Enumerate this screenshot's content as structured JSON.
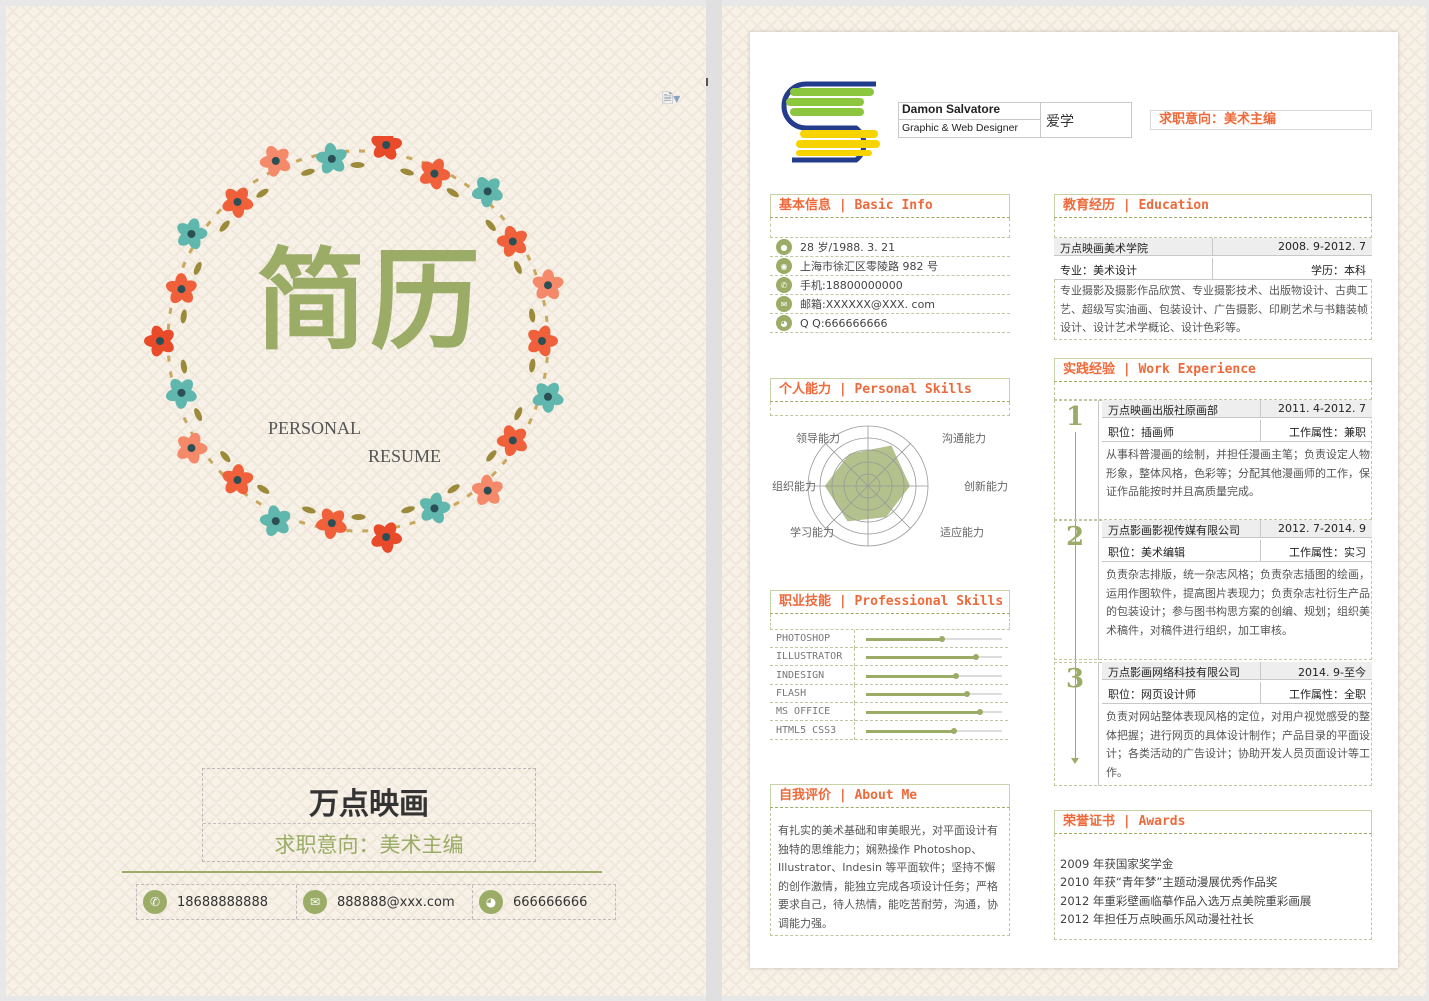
{
  "left": {
    "title": "简历",
    "subtitle_1": "PERSONAL",
    "subtitle_2": "RESUME",
    "name": "万点映画",
    "intent": "求职意向：美术主编",
    "contacts": [
      {
        "icon": "phone-icon",
        "glyph": "✆",
        "text": "18688888888"
      },
      {
        "icon": "mail-icon",
        "glyph": "✉",
        "text": "888888@xxx.com"
      },
      {
        "icon": "qq-icon",
        "glyph": "◕",
        "text": "666666666"
      }
    ]
  },
  "header": {
    "name": "Damon Salvatore",
    "role": "Graphic & Web Designer",
    "motto": "爱学",
    "intent": "求职意向：美术主编"
  },
  "basic": {
    "title": "基本信息 | Basic Info",
    "items": [
      {
        "icon": "user-icon",
        "text": "28 岁/1988. 3. 21"
      },
      {
        "icon": "location-icon",
        "text": "上海市徐汇区零陵路 982 号"
      },
      {
        "icon": "phone-icon",
        "text": "手机:18800000000"
      },
      {
        "icon": "mail-icon",
        "text": "邮箱:XXXXXX@XXX. com"
      },
      {
        "icon": "qq-icon",
        "text": "Q  Q:666666666"
      }
    ]
  },
  "personal": {
    "title": "个人能力 | Personal Skills",
    "labels": [
      "领导能力",
      "沟通能力",
      "组织能力",
      "创新能力",
      "学习能力",
      "适应能力"
    ],
    "values": [
      0.62,
      0.78,
      0.72,
      0.7,
      0.68,
      0.6
    ]
  },
  "professional": {
    "title": "职业技能 | Professional Skills",
    "skills": [
      {
        "name": "PHOTOSHOP",
        "level": 0.56
      },
      {
        "name": "ILLUSTRATOR",
        "level": 0.81
      },
      {
        "name": "INDESIGN",
        "level": 0.66
      },
      {
        "name": "FLASH",
        "level": 0.74
      },
      {
        "name": "MS OFFICE",
        "level": 0.84
      },
      {
        "name": "HTML5 CSS3",
        "level": 0.65
      }
    ]
  },
  "about": {
    "title": "自我评价 | About Me",
    "text": "有扎实的美术基础和审美眼光，对平面设计有独特的思维能力；娴熟操作 Photoshop、Illustrator、Indesin 等平面软件；坚持不懈的创作激情，能独立完成各项设计任务；严格要求自己，待人热情，能吃苦耐劳，沟通，协调能力强。"
  },
  "education": {
    "title": "教育经历 | Education",
    "school": "万点映画美术学院",
    "period": "2008. 9-2012. 7",
    "major": "专业：美术设计",
    "degree": "学历：本科",
    "desc": "专业摄影及摄影作品欣赏、专业摄影技术、出版物设计、古典工艺、超级写实油画、包装设计、广告摄影、印刷艺术与书籍装帧设计、设计艺术学概论、设计色彩等。"
  },
  "work": {
    "title": "实践经验 | Work Experience",
    "jobs": [
      {
        "num": "1",
        "company": "万点映画出版社原画部",
        "period": "2011. 4-2012. 7",
        "position": "职位：插画师",
        "type": "工作属性：兼职",
        "desc": "从事科普漫画的绘制，并担任漫画主笔；负责设定人物形象，整体风格，色彩等；分配其他漫画师的工作，保证作品能按时并且高质量完成。"
      },
      {
        "num": "2",
        "company": "万点影画影视传媒有限公司",
        "period": "2012. 7-2014. 9",
        "position": "职位：美术编辑",
        "type": "工作属性：实习",
        "desc": "负责杂志排版，统一杂志风格；负责杂志插图的绘画，运用作图软件，提高图片表现力；负责杂志社衍生产品的包装设计；参与图书构思方案的创编、规划；组织美术稿件，对稿件进行组织，加工审核。"
      },
      {
        "num": "3",
        "company": "万点影画网络科技有限公司",
        "period": "2014. 9-至今",
        "position": "职位：网页设计师",
        "type": "工作属性：全职",
        "desc": "负责对网站整体表现风格的定位，对用户视觉感受的整体把握；进行网页的具体设计制作；产品目录的平面设计；各类活动的广告设计；协助开发人员页面设计等工作。"
      }
    ]
  },
  "awards": {
    "title": "荣誉证书 | Awards",
    "items": [
      "2009 年获国家奖学金",
      "2010 年获“青年梦”主题动漫展优秀作品奖",
      "2012 年重彩壁画临摹作品入选万点美院重彩画展",
      "2012 年担任万点映画乐风动漫社社长"
    ]
  },
  "colors": {
    "accent": "#9aac66",
    "heading": "#ee6a3b"
  }
}
